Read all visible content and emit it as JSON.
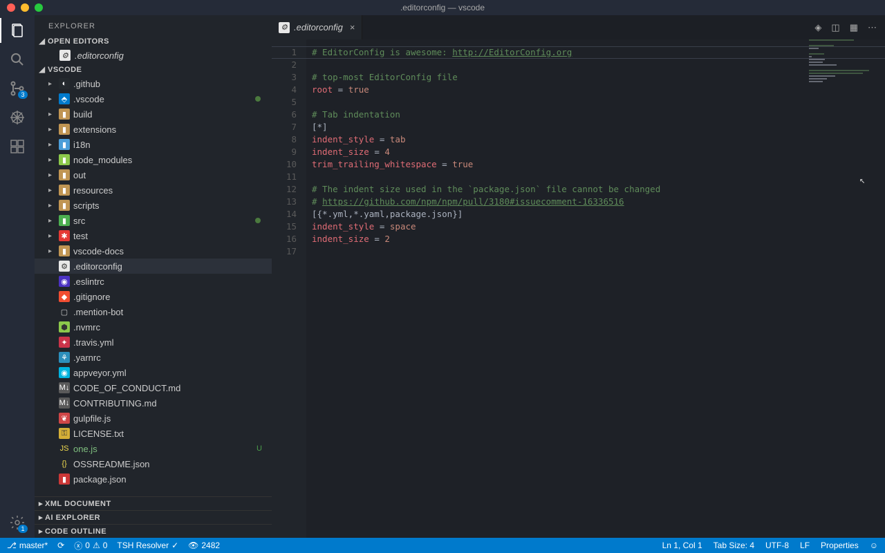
{
  "title": ".editorconfig — vscode",
  "explorer": {
    "title": "EXPLORER"
  },
  "sections": {
    "open_editors": "OPEN EDITORS",
    "workspace": "VSCODE",
    "xml": "XML DOCUMENT",
    "ai": "AI EXPLORER",
    "outline": "CODE OUTLINE"
  },
  "open_editor_file": ".editorconfig",
  "tree": [
    {
      "name": ".github",
      "type": "folder",
      "icon": "gh",
      "depth": 0
    },
    {
      "name": ".vscode",
      "type": "folder",
      "icon": "vs",
      "depth": 0,
      "modified": true
    },
    {
      "name": "build",
      "type": "folder",
      "icon": "fd",
      "depth": 0
    },
    {
      "name": "extensions",
      "type": "folder",
      "icon": "fd",
      "depth": 0
    },
    {
      "name": "i18n",
      "type": "folder",
      "icon": "i18n",
      "depth": 0
    },
    {
      "name": "node_modules",
      "type": "folder",
      "icon": "nm",
      "depth": 0
    },
    {
      "name": "out",
      "type": "folder",
      "icon": "fd",
      "depth": 0
    },
    {
      "name": "resources",
      "type": "folder",
      "icon": "fd",
      "depth": 0
    },
    {
      "name": "scripts",
      "type": "folder",
      "icon": "fd",
      "depth": 0
    },
    {
      "name": "src",
      "type": "folder",
      "icon": "src",
      "depth": 0,
      "modified": true
    },
    {
      "name": "test",
      "type": "folder",
      "icon": "test",
      "depth": 0
    },
    {
      "name": "vscode-docs",
      "type": "folder",
      "icon": "fd",
      "depth": 0
    },
    {
      "name": ".editorconfig",
      "type": "file",
      "icon": "ec",
      "depth": 0,
      "selected": true
    },
    {
      "name": ".eslintrc",
      "type": "file",
      "icon": "es",
      "depth": 0
    },
    {
      "name": ".gitignore",
      "type": "file",
      "icon": "git",
      "depth": 0
    },
    {
      "name": ".mention-bot",
      "type": "file",
      "icon": "doc",
      "depth": 0
    },
    {
      "name": ".nvmrc",
      "type": "file",
      "icon": "nvm",
      "depth": 0
    },
    {
      "name": ".travis.yml",
      "type": "file",
      "icon": "trv",
      "depth": 0
    },
    {
      "name": ".yarnrc",
      "type": "file",
      "icon": "yarn",
      "depth": 0
    },
    {
      "name": "appveyor.yml",
      "type": "file",
      "icon": "av",
      "depth": 0
    },
    {
      "name": "CODE_OF_CONDUCT.md",
      "type": "file",
      "icon": "md",
      "depth": 0
    },
    {
      "name": "CONTRIBUTING.md",
      "type": "file",
      "icon": "md",
      "depth": 0
    },
    {
      "name": "gulpfile.js",
      "type": "file",
      "icon": "gulp",
      "depth": 0
    },
    {
      "name": "LICENSE.txt",
      "type": "file",
      "icon": "lic",
      "depth": 0
    },
    {
      "name": "one.js",
      "type": "file",
      "icon": "js",
      "depth": 0,
      "status": "U",
      "green": true
    },
    {
      "name": "OSSREADME.json",
      "type": "file",
      "icon": "json",
      "depth": 0
    },
    {
      "name": "package.json",
      "type": "file",
      "icon": "npm",
      "depth": 0
    }
  ],
  "tab": {
    "label": ".editorconfig"
  },
  "code": {
    "lines": [
      {
        "n": 1,
        "seg": [
          {
            "t": "# EditorConfig is awesome: ",
            "c": "c-comment"
          },
          {
            "t": "http://EditorConfig.org",
            "c": "c-link"
          }
        ]
      },
      {
        "n": 2,
        "seg": []
      },
      {
        "n": 3,
        "seg": [
          {
            "t": "# top-most EditorConfig file",
            "c": "c-comment"
          }
        ]
      },
      {
        "n": 4,
        "seg": [
          {
            "t": "root",
            "c": "c-key"
          },
          {
            "t": " = ",
            "c": "c-op"
          },
          {
            "t": "true",
            "c": "c-val"
          }
        ]
      },
      {
        "n": 5,
        "seg": []
      },
      {
        "n": 6,
        "seg": [
          {
            "t": "# Tab indentation",
            "c": "c-comment"
          }
        ]
      },
      {
        "n": 7,
        "seg": [
          {
            "t": "[*]",
            "c": "c-sec"
          }
        ]
      },
      {
        "n": 8,
        "seg": [
          {
            "t": "indent_style",
            "c": "c-key"
          },
          {
            "t": " = ",
            "c": "c-op"
          },
          {
            "t": "tab",
            "c": "c-val"
          }
        ]
      },
      {
        "n": 9,
        "seg": [
          {
            "t": "indent_size",
            "c": "c-key"
          },
          {
            "t": " = ",
            "c": "c-op"
          },
          {
            "t": "4",
            "c": "c-num"
          }
        ]
      },
      {
        "n": 10,
        "seg": [
          {
            "t": "trim_trailing_whitespace",
            "c": "c-key"
          },
          {
            "t": " = ",
            "c": "c-op"
          },
          {
            "t": "true",
            "c": "c-val"
          }
        ]
      },
      {
        "n": 11,
        "seg": []
      },
      {
        "n": 12,
        "seg": [
          {
            "t": "# The indent size used in the `package.json` file cannot be changed",
            "c": "c-comment"
          }
        ]
      },
      {
        "n": 13,
        "seg": [
          {
            "t": "# ",
            "c": "c-comment"
          },
          {
            "t": "https://github.com/npm/npm/pull/3180#issuecomment-16336516",
            "c": "c-link"
          }
        ]
      },
      {
        "n": 14,
        "seg": [
          {
            "t": "[{*.yml,*.yaml,package.json}]",
            "c": "c-sec"
          }
        ]
      },
      {
        "n": 15,
        "seg": [
          {
            "t": "indent_style",
            "c": "c-key"
          },
          {
            "t": " = ",
            "c": "c-op"
          },
          {
            "t": "space",
            "c": "c-val"
          }
        ]
      },
      {
        "n": 16,
        "seg": [
          {
            "t": "indent_size",
            "c": "c-key"
          },
          {
            "t": " = ",
            "c": "c-op"
          },
          {
            "t": "2",
            "c": "c-num"
          }
        ]
      },
      {
        "n": 17,
        "seg": []
      }
    ]
  },
  "scm_badge": "3",
  "settings_badge": "1",
  "statusbar": {
    "branch": "master*",
    "errors": "0",
    "warnings": "0",
    "tsh": "TSH Resolver",
    "views": "2482",
    "lncol": "Ln 1, Col 1",
    "tabsize": "Tab Size: 4",
    "encoding": "UTF-8",
    "eol": "LF",
    "lang": "Properties"
  },
  "icons": {
    "gh": {
      "bg": "#24292e",
      "fg": "#fff",
      "ch": "◐"
    },
    "vs": {
      "bg": "#007acc",
      "fg": "#fff",
      "ch": "⬘"
    },
    "fd": {
      "bg": "#c09553",
      "fg": "#fff",
      "ch": "▮"
    },
    "i18n": {
      "bg": "#4b9ed9",
      "fg": "#fff",
      "ch": "▮"
    },
    "nm": {
      "bg": "#8cc84b",
      "fg": "#fff",
      "ch": "▮"
    },
    "src": {
      "bg": "#4caf50",
      "fg": "#fff",
      "ch": "▮"
    },
    "test": {
      "bg": "#e53935",
      "fg": "#fff",
      "ch": "✱"
    },
    "ec": {
      "bg": "#e8e8e8",
      "fg": "#333",
      "ch": "⚙"
    },
    "es": {
      "bg": "#4b32c3",
      "fg": "#fff",
      "ch": "◉"
    },
    "git": {
      "bg": "#f14e32",
      "fg": "#fff",
      "ch": "◆"
    },
    "doc": {
      "bg": "transparent",
      "fg": "#ccc",
      "ch": "▢"
    },
    "nvm": {
      "bg": "#8cc84b",
      "fg": "#333",
      "ch": "⬢"
    },
    "trv": {
      "bg": "#cb3349",
      "fg": "#fff",
      "ch": "✦"
    },
    "yarn": {
      "bg": "#2c8ebb",
      "fg": "#fff",
      "ch": "⚘"
    },
    "av": {
      "bg": "#00b3e0",
      "fg": "#fff",
      "ch": "◉"
    },
    "md": {
      "bg": "#5a5a5a",
      "fg": "#fff",
      "ch": "M↓"
    },
    "gulp": {
      "bg": "#cf4647",
      "fg": "#fff",
      "ch": "❦"
    },
    "lic": {
      "bg": "#d4af37",
      "fg": "#333",
      "ch": "⚿"
    },
    "js": {
      "bg": "transparent",
      "fg": "#f0db4f",
      "ch": "JS"
    },
    "json": {
      "bg": "transparent",
      "fg": "#f0db4f",
      "ch": "{}"
    },
    "npm": {
      "bg": "#cb3837",
      "fg": "#fff",
      "ch": "▮"
    }
  }
}
